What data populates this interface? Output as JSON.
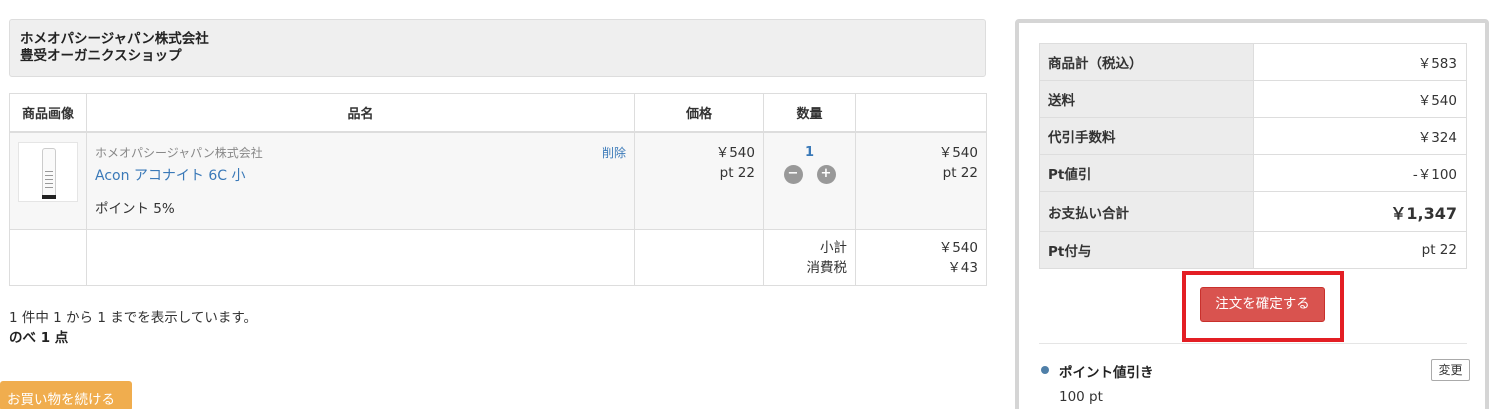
{
  "shop": {
    "company": "ホメオパシージャパン株式会社",
    "store": "豊受オーガニクスショップ"
  },
  "cart": {
    "headers": {
      "image": "商品画像",
      "name": "品名",
      "price": "価格",
      "qty": "数量"
    },
    "item": {
      "maker": "ホメオパシージャパン株式会社",
      "delete": "削除",
      "product": "Acon アコナイト 6C 小",
      "points": "ポイント 5%",
      "price": "￥540",
      "price_pt": "pt 22",
      "qty": "1",
      "minus": "−",
      "plus": "+",
      "total": "￥540",
      "total_pt": "pt 22"
    },
    "subtotal_label": "小計",
    "subtotal": "￥540",
    "tax_label": "消費税",
    "tax": "￥43"
  },
  "list": {
    "count_text": "1 件中 1 から 1 までを表示しています。",
    "total_items": "のべ 1 点"
  },
  "continue_button": "お買い物を続ける",
  "summary": {
    "rows": [
      {
        "label": "商品計（税込）",
        "value": "￥583"
      },
      {
        "label": "送料",
        "value": "￥540"
      },
      {
        "label": "代引手数料",
        "value": "￥324"
      },
      {
        "label": "Pt値引",
        "value": "-￥100"
      },
      {
        "label": "お支払い合計",
        "value": "￥1,347"
      },
      {
        "label": "Pt付与",
        "value": "pt 22"
      }
    ],
    "confirm_button": "注文を確定する",
    "point_discount_title": "ポイント値引き",
    "change_button": "変更",
    "point_discount_value": "100 pt"
  },
  "colors": {
    "accent_blue": "#3a79b8",
    "confirm_red": "#d9534f",
    "highlight_red": "#e31e24",
    "continue_orange": "#f0ad4e"
  },
  "icons": [
    "product-thumbnail",
    "minus-icon",
    "plus-icon",
    "bullet-icon"
  ]
}
